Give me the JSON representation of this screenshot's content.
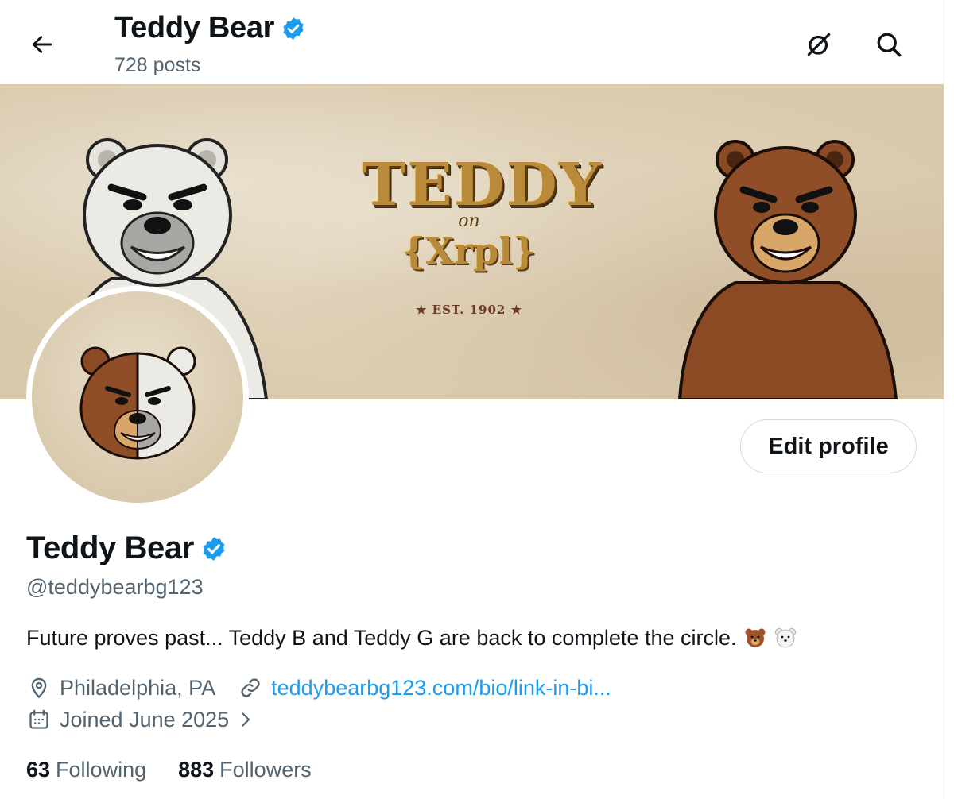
{
  "header": {
    "title": "Teddy Bear",
    "posts_count": "728 posts",
    "back_icon": "arrow-left-icon",
    "grok_icon": "grok-icon",
    "search_icon": "search-icon"
  },
  "banner": {
    "logo_line1": "TEDDY",
    "logo_line2": "on",
    "logo_line3": "{Xrpl}",
    "logo_est": "★ EST. 1902 ★"
  },
  "profile": {
    "name": "Teddy Bear",
    "handle": "@teddybearbg123",
    "bio": "Future proves past... Teddy B and Teddy G are back to complete the circle.",
    "bio_emoji": [
      "brown-bear-emoji",
      "polar-bear-emoji"
    ],
    "location": "Philadelphia, PA",
    "website": "teddybearbg123.com/bio/link-in-bi...",
    "joined": "Joined June 2025",
    "following_count": "63",
    "following_label": "Following",
    "followers_count": "883",
    "followers_label": "Followers",
    "edit_button": "Edit profile"
  },
  "colors": {
    "accent": "#1d9bf0",
    "secondary_text": "#536471",
    "primary_text": "#0f1419"
  }
}
